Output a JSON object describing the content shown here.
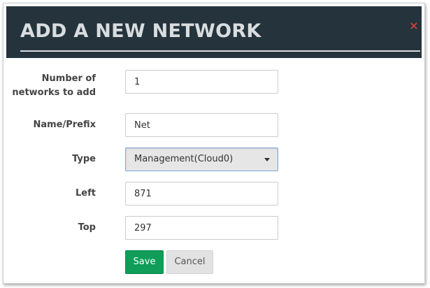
{
  "dialog": {
    "title": "ADD A NEW NETWORK",
    "close_glyph": "×"
  },
  "form": {
    "num_networks": {
      "label_line1": "Number of",
      "label_line2": "networks to add",
      "value": "1"
    },
    "name_prefix": {
      "label": "Name/Prefix",
      "value": "Net"
    },
    "type": {
      "label": "Type",
      "selected": "Management(Cloud0)"
    },
    "left": {
      "label": "Left",
      "value": "871"
    },
    "top": {
      "label": "Top",
      "value": "297"
    }
  },
  "buttons": {
    "save_label": "Save",
    "cancel_label": "Cancel"
  },
  "colors": {
    "header_bg": "#25343c",
    "title_text": "#d9dde0",
    "close_icon": "#d63a3a",
    "save_bg": "#0f9d58",
    "cancel_bg": "#e2e2e2",
    "select_border": "#7fa6d6"
  },
  "icons": {
    "close": "close-icon",
    "dropdown": "chevron-down-icon"
  }
}
